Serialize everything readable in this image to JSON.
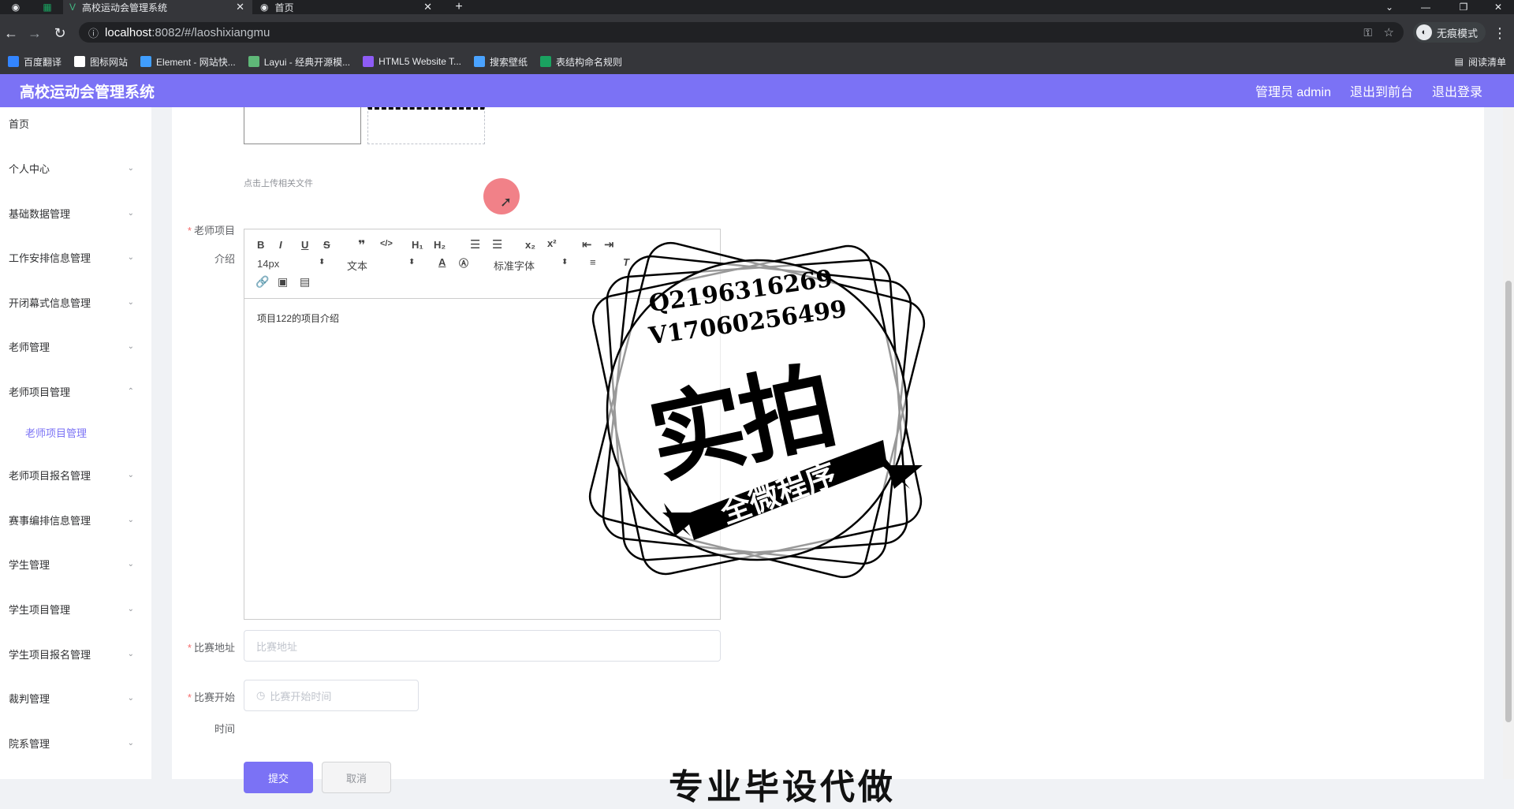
{
  "browser": {
    "tabs": [
      {
        "title": "高校运动会管理系统",
        "active": true
      },
      {
        "title": "首页",
        "active": false
      }
    ],
    "new_tab": "+",
    "url_host": "localhost",
    "url_rest": ":8082/#/laoshixiangmu",
    "incognito_label": "无痕模式",
    "bookmarks": [
      {
        "label": "百度翻译",
        "color": "#3385ff"
      },
      {
        "label": "图标网站",
        "color": "#ffffff"
      },
      {
        "label": "Element - 网站快...",
        "color": "#409eff"
      },
      {
        "label": "Layui - 经典开源模...",
        "color": "#5fb878"
      },
      {
        "label": "HTML5 Website T...",
        "color": "#8e5cf5"
      },
      {
        "label": "搜索壁纸",
        "color": "#4aa3ff"
      },
      {
        "label": "表结构命名规则",
        "color": "#1aa260"
      }
    ],
    "reading_list": "阅读清单"
  },
  "header": {
    "title": "高校运动会管理系统",
    "admin": "管理员 admin",
    "exit_front": "退出到前台",
    "logout": "退出登录"
  },
  "sidebar": {
    "items": [
      {
        "label": "首页"
      },
      {
        "label": "个人中心"
      },
      {
        "label": "基础数据管理"
      },
      {
        "label": "工作安排信息管理"
      },
      {
        "label": "开闭幕式信息管理"
      },
      {
        "label": "老师管理"
      },
      {
        "label": "老师项目管理"
      },
      {
        "label": "老师项目管理"
      },
      {
        "label": "老师项目报名管理"
      },
      {
        "label": "赛事编排信息管理"
      },
      {
        "label": "学生管理"
      },
      {
        "label": "学生项目管理"
      },
      {
        "label": "学生项目报名管理"
      },
      {
        "label": "裁判管理"
      },
      {
        "label": "院系管理"
      }
    ]
  },
  "form": {
    "upload_hint": "点击上传相关文件",
    "intro_label_1": "老师项目",
    "intro_label_2": "介绍",
    "editor": {
      "font_size": "14px",
      "block_type": "文本",
      "font_family": "标准字体",
      "content": "项目122的项目介绍"
    },
    "address_label": "比赛地址",
    "address_placeholder": "比赛地址",
    "start_label_1": "比赛开始",
    "start_label_2": "时间",
    "start_placeholder": "比赛开始时间",
    "submit": "提交",
    "cancel": "取消"
  },
  "watermark": {
    "line1": "Q2196316269",
    "line2": "V17060256499",
    "big": "实拍",
    "ribbon": "全微程序",
    "bottom": "专业毕设代做"
  }
}
